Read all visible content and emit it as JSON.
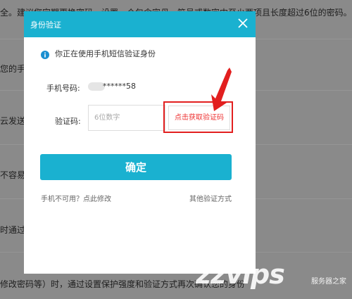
{
  "background": {
    "line1": "全。建议您定期更换密码，设置一个包含字母，符号或数字中至少两项且长度超过6位的密码。",
    "line2": "您的手",
    "line3": "云发送",
    "line4": "不容易",
    "line5": "时通过",
    "line6": "修改密码等）时，通过设置保护强度和验证方式再次确认您的身份"
  },
  "dialog": {
    "title": "身份验证",
    "info": "你正在使用手机短信验证身份",
    "phone_label": "手机号码:",
    "phone_value": "******58",
    "code_label": "验证码:",
    "code_placeholder": "6位数字",
    "get_code_label": "点击获取验证码",
    "confirm_label": "确定",
    "phone_unavailable_link": "手机不可用？点此修改",
    "other_method_link": "其他验证方式"
  },
  "watermark": {
    "main": "zzvips",
    "sub": "服务器之家"
  },
  "colors": {
    "accent": "#1ab1d0",
    "highlight": "#e21f1f"
  }
}
